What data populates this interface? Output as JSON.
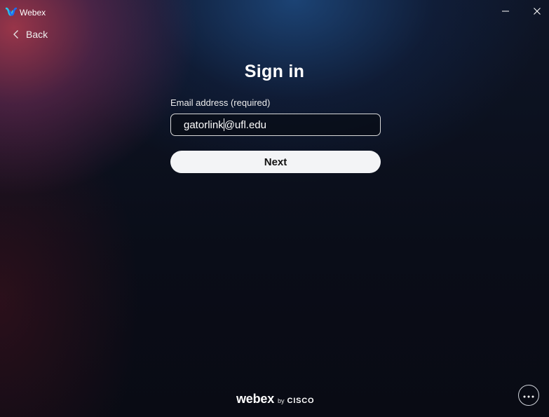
{
  "window": {
    "title": "Webex",
    "logo_icon": "webex-logo-icon",
    "minimize_icon": "minimize-icon",
    "close_icon": "close-icon"
  },
  "nav": {
    "back_label": "Back",
    "back_icon": "chevron-left-icon"
  },
  "signin": {
    "title": "Sign in",
    "email_label": "Email address (required)",
    "email_value_before_caret": "gatorlink",
    "email_value_after_caret": "@ufl.edu",
    "next_label": "Next"
  },
  "footer": {
    "brand_name": "webex",
    "brand_by": "by",
    "brand_company": "CISCO",
    "more_icon": "more-horizontal-icon"
  },
  "colors": {
    "accent_blue": "#1f8ff0",
    "accent_teal": "#2fc5e8",
    "button_bg": "#f3f4f6",
    "background": "#0a0d18"
  }
}
